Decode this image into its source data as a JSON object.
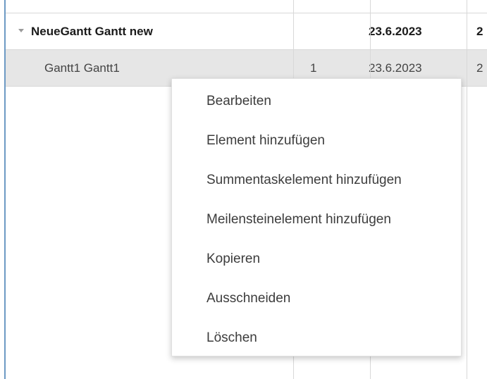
{
  "grid": {
    "rows": [
      {
        "name": "NeueGantt Gantt new",
        "col2": "",
        "date": "23.6.2023",
        "next": "2"
      },
      {
        "name": "Gantt1 Gantt1",
        "col2": "1",
        "date": "23.6.2023",
        "next": "2"
      }
    ]
  },
  "context_menu": {
    "items": [
      {
        "label": "Bearbeiten"
      },
      {
        "label": "Element hinzufügen"
      },
      {
        "label": "Summentaskelement hinzufügen"
      },
      {
        "label": "Meilensteinelement hinzufügen"
      },
      {
        "label": "Kopieren"
      },
      {
        "label": "Ausschneiden"
      },
      {
        "label": "Löschen"
      }
    ]
  },
  "colors": {
    "selected_row": "#e6e6e6",
    "grid_line": "#d8d8d8",
    "frame_border": "#6d9ac4"
  }
}
